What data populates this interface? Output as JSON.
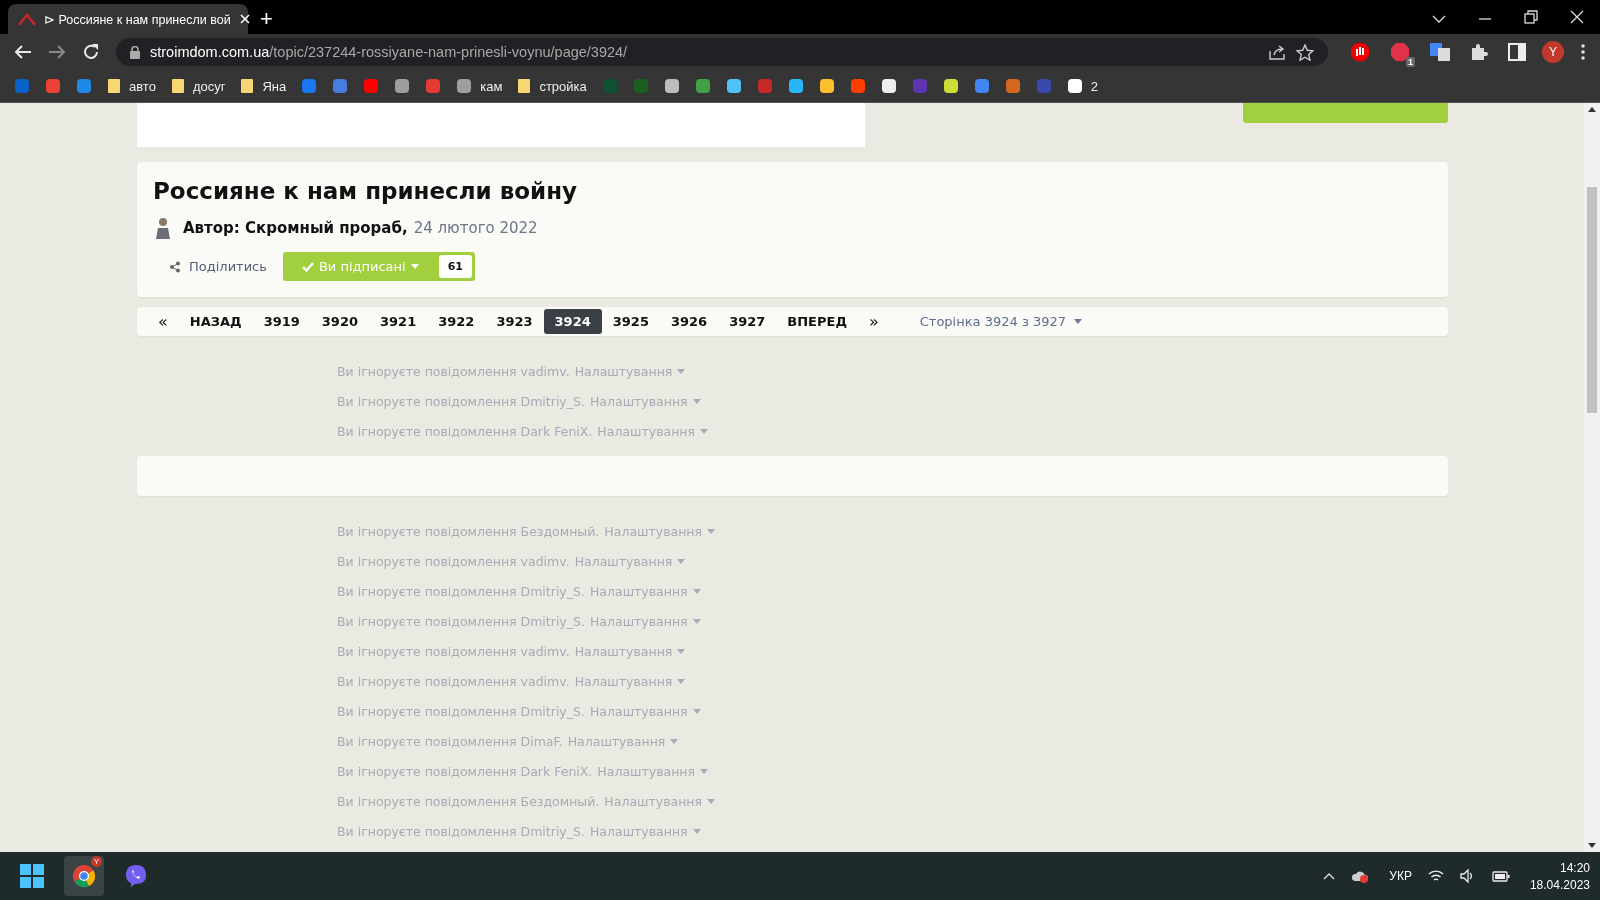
{
  "browser": {
    "tab": {
      "title": "⊳ Россияне к нам принесли вой",
      "selected": true
    },
    "new_tab": "+",
    "url": {
      "domain": "stroimdom.com.ua",
      "path": "/topic/237244-rossiyane-nam-prinesli-voynu/page/3924/"
    },
    "bookmarks": [
      {
        "kind": "site",
        "color": "#0a64c8"
      },
      {
        "kind": "site",
        "color": "#ea4335"
      },
      {
        "kind": "site",
        "color": "#1e88e5"
      },
      {
        "kind": "folder",
        "label": "авто"
      },
      {
        "kind": "folder",
        "label": "досуг"
      },
      {
        "kind": "folder",
        "label": "Яна"
      },
      {
        "kind": "site",
        "color": "#1877f2"
      },
      {
        "kind": "site",
        "color": "#4a7de0"
      },
      {
        "kind": "site",
        "color": "#ff0000"
      },
      {
        "kind": "site",
        "color": "#9e9e9e"
      },
      {
        "kind": "site",
        "color": "#e53935"
      },
      {
        "kind": "site",
        "color": "#9e9e9e",
        "label": "кам"
      },
      {
        "kind": "folder",
        "label": "стройка"
      },
      {
        "kind": "site",
        "color": "#0f5132"
      },
      {
        "kind": "site",
        "color": "#1b5e20"
      },
      {
        "kind": "site",
        "color": "#bdbdbd"
      },
      {
        "kind": "site",
        "color": "#43a047"
      },
      {
        "kind": "site",
        "color": "#4fc3f7"
      },
      {
        "kind": "site",
        "color": "#c62828"
      },
      {
        "kind": "site",
        "color": "#29b6f6"
      },
      {
        "kind": "site",
        "color": "#fbc02d"
      },
      {
        "kind": "site",
        "color": "#ff3d00"
      },
      {
        "kind": "site",
        "color": "#eeeeee"
      },
      {
        "kind": "site",
        "color": "#5e35b1"
      },
      {
        "kind": "site",
        "color": "#cddc39"
      },
      {
        "kind": "site",
        "color": "#4285f4"
      },
      {
        "kind": "site",
        "color": "#d2691e"
      },
      {
        "kind": "site",
        "color": "#3949ab"
      },
      {
        "kind": "site",
        "color": "#ffffff",
        "label": "2"
      }
    ],
    "extension_badge": "1",
    "profile": "Y"
  },
  "topic": {
    "title": "Россияне к нам принесли войну",
    "author": "Автор: Скромный прораб,",
    "date": "24 лютого 2022",
    "share": "Поділитись",
    "follow": "Ви підписані",
    "followers": "61"
  },
  "pagination": {
    "first": "«",
    "prev": "НАЗАД",
    "pages": [
      {
        "label": "3919",
        "selected": false
      },
      {
        "label": "3920",
        "selected": false
      },
      {
        "label": "3921",
        "selected": false
      },
      {
        "label": "3922",
        "selected": false
      },
      {
        "label": "3923",
        "selected": false
      },
      {
        "label": "3924",
        "selected": true
      },
      {
        "label": "3925",
        "selected": false
      },
      {
        "label": "3926",
        "selected": false
      },
      {
        "label": "3927",
        "selected": false
      }
    ],
    "next": "ВПЕРЕД",
    "last": "»",
    "jump": "Сторінка 3924 з 3927"
  },
  "ignored_groups": [
    [
      {
        "text": "Ви ігноруєте повідомлення vadimv.",
        "settings": "Налаштування"
      },
      {
        "text": "Ви ігноруєте повідомлення Dmitriy_S.",
        "settings": "Налаштування"
      },
      {
        "text": "Ви ігноруєте повідомлення Dark FeniX.",
        "settings": "Налаштування"
      }
    ],
    [
      {
        "text": "Ви ігноруєте повідомлення Бездомный.",
        "settings": "Налаштування"
      },
      {
        "text": "Ви ігноруєте повідомлення vadimv.",
        "settings": "Налаштування"
      },
      {
        "text": "Ви ігноруєте повідомлення Dmitriy_S.",
        "settings": "Налаштування"
      },
      {
        "text": "Ви ігноруєте повідомлення Dmitriy_S.",
        "settings": "Налаштування"
      },
      {
        "text": "Ви ігноруєте повідомлення vadimv.",
        "settings": "Налаштування"
      },
      {
        "text": "Ви ігноруєте повідомлення vadimv.",
        "settings": "Налаштування"
      },
      {
        "text": "Ви ігноруєте повідомлення Dmitriy_S.",
        "settings": "Налаштування"
      },
      {
        "text": "Ви ігноруєте повідомлення DimaF.",
        "settings": "Налаштування"
      },
      {
        "text": "Ви ігноруєте повідомлення Dark FeniX.",
        "settings": "Налаштування"
      },
      {
        "text": "Ви ігноруєте повідомлення Бездомный.",
        "settings": "Налаштування"
      },
      {
        "text": "Ви ігноруєте повідомлення Dmitriy_S.",
        "settings": "Налаштування"
      }
    ]
  ],
  "taskbar": {
    "language": "УКР",
    "time": "14:20",
    "date": "18.04.2023",
    "chrome_badge": "Y"
  }
}
